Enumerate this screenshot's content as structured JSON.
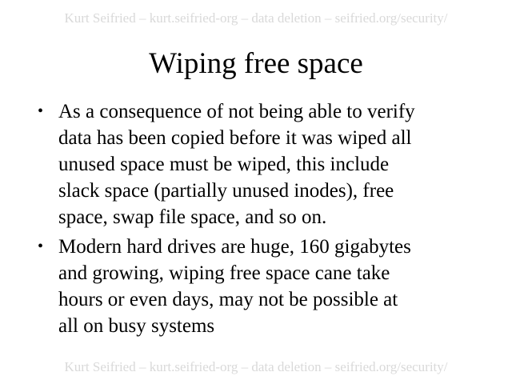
{
  "header": {
    "text": "Kurt Seifried – kurt.seifried-org – data deletion – seifried.org/security/"
  },
  "title": "Wiping free space",
  "bullets": [
    {
      "lines": [
        "As a consequence of not being able to verify",
        "data has been copied before it was wiped all",
        "unused space must be wiped, this include",
        "slack space (partially unused inodes), free",
        "space, swap file space, and so on."
      ]
    },
    {
      "lines": [
        "Modern hard drives are huge, 160 gigabytes",
        "and growing, wiping free space cane take",
        "hours or even days, may not be possible at",
        "all on busy systems"
      ]
    }
  ],
  "footer": {
    "text": "Kurt Seifried – kurt.seifried-org – data deletion – seifried.org/security/"
  },
  "colors": {
    "watermark_text": "#d9d9d9",
    "body_text": "#000000",
    "background": "#ffffff"
  },
  "icons": {
    "bullet": "•"
  }
}
